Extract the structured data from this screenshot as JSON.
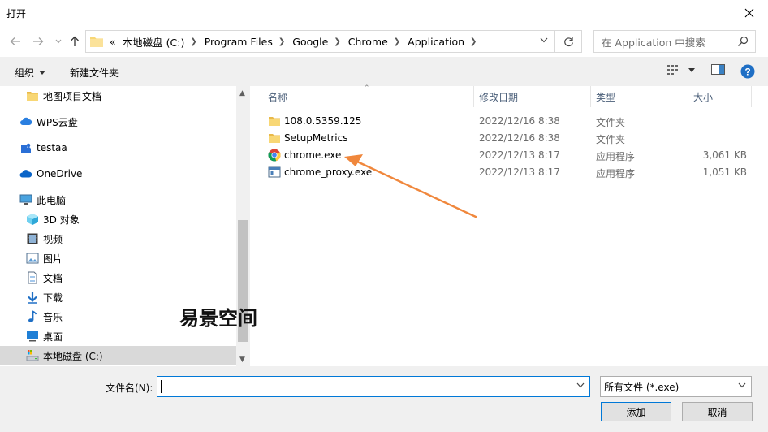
{
  "window": {
    "title": "打开"
  },
  "address": {
    "overflow": "«",
    "crumbs": [
      "本地磁盘 (C:)",
      "Program Files",
      "Google",
      "Chrome",
      "Application"
    ]
  },
  "search": {
    "placeholder": "在 Application 中搜索"
  },
  "toolbar": {
    "organize": "组织",
    "new_folder": "新建文件夹"
  },
  "nav": {
    "items": [
      {
        "label": "地图项目文档",
        "icon": "folder-icon"
      },
      {
        "label": "WPS云盘",
        "icon": "wps-cloud-icon"
      },
      {
        "label": "testaa",
        "icon": "user-folder-icon"
      },
      {
        "label": "OneDrive",
        "icon": "onedrive-icon"
      },
      {
        "label": "此电脑",
        "icon": "computer-icon"
      },
      {
        "label": "3D 对象",
        "icon": "3d-objects-icon"
      },
      {
        "label": "视频",
        "icon": "video-icon"
      },
      {
        "label": "图片",
        "icon": "pictures-icon"
      },
      {
        "label": "文档",
        "icon": "documents-icon"
      },
      {
        "label": "下载",
        "icon": "download-icon"
      },
      {
        "label": "音乐",
        "icon": "music-icon"
      },
      {
        "label": "桌面",
        "icon": "desktop-icon"
      },
      {
        "label": "本地磁盘 (C:)",
        "icon": "drive-icon"
      }
    ]
  },
  "columns": {
    "name": "名称",
    "date": "修改日期",
    "type": "类型",
    "size": "大小"
  },
  "files": [
    {
      "name": "108.0.5359.125",
      "date": "2022/12/16 8:38",
      "type": "文件夹",
      "size": "",
      "icon": "folder-icon"
    },
    {
      "name": "SetupMetrics",
      "date": "2022/12/16 8:38",
      "type": "文件夹",
      "size": "",
      "icon": "folder-icon"
    },
    {
      "name": "chrome.exe",
      "date": "2022/12/13 8:17",
      "type": "应用程序",
      "size": "3,061 KB",
      "icon": "chrome-icon"
    },
    {
      "name": "chrome_proxy.exe",
      "date": "2022/12/13 8:17",
      "type": "应用程序",
      "size": "1,051 KB",
      "icon": "exe-icon"
    }
  ],
  "bottom": {
    "filename_label": "文件名(N):",
    "filename_value": "",
    "filter_value": "所有文件 (*.exe)",
    "open_label": "添加",
    "cancel_label": "取消"
  },
  "watermark": "易景空间",
  "colors": {
    "accent": "#0078d7",
    "folder": "#f8d775",
    "arrow": "#f0873c",
    "selection": "#cce8ff"
  }
}
